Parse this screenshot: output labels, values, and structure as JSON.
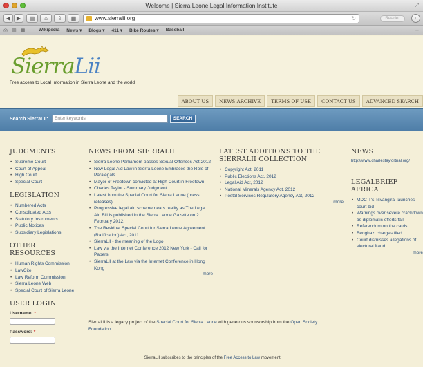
{
  "browser": {
    "window_title": "Welcome | Sierra Leone Legal Information Institute",
    "url": "www.sierralii.org",
    "reader_label": "Reader",
    "bookmarks": [
      "Wikipedia",
      "News ▾",
      "Blogs ▾",
      "411 ▾",
      "Bike Routes ▾",
      "Baseball"
    ]
  },
  "site": {
    "logo_part1": "Sierra",
    "logo_part2": "Lii",
    "tagline": "Free access to Local Information in Sierra Leone and the world",
    "nav": [
      "ABOUT US",
      "NEWS ARCHIVE",
      "TERMS OF USE",
      "CONTACT US",
      "ADVANCED SEARCH"
    ],
    "search": {
      "label": "Search SierraLII:",
      "placeholder": "Enter keywords",
      "button": "SEARCH"
    }
  },
  "judgments": {
    "heading": "JUDGMENTS",
    "items": [
      "Supreme Court",
      "Court of Appeal",
      "High Court",
      "Special Court"
    ]
  },
  "legislation": {
    "heading": "LEGISLATION",
    "items": [
      "Numbered Acts",
      "Consolidated Acts",
      "Statutory Instruments",
      "Public Notices",
      "Subsidiary Legislations"
    ]
  },
  "other_resources": {
    "heading": "OTHER RESOURCES",
    "items": [
      "Human Rights Commission",
      "LawCite",
      "Law Reform Commission",
      "Sierra Leone Web",
      "Special Court of Sierra Leone"
    ]
  },
  "login": {
    "heading": "USER LOGIN",
    "username_label": "Username:",
    "password_label": "Password:",
    "required_mark": "*"
  },
  "news": {
    "heading": "NEWS FROM SIERRALII",
    "items": [
      "Sierra Leone Parliament passes Sexual Offences Act 2012",
      "New Legal Aid Law in Sierra Leone Embraces the Role of Paralegals",
      "Mayor of Freetown convicted at High Court in Freetown",
      "Charles Taylor - Summary Judgment",
      "Latest from the Special Court for Sierra Leone (press releases)",
      "Progressive legal aid scheme nears reality as The Legal Aid Bill is published in the Sierra Leone Gazette on 2 February 2012.",
      "The Residual Special Court for Sierra Leone Agreement (Ratification) Act, 2011",
      "SierraLII - the meaning of the Logo",
      "Law via the Internet Conference 2012 New York - Call for Papers",
      "SierraLII at the Law via the Internet Conference in Hong Kong"
    ],
    "more": "more"
  },
  "latest": {
    "heading": "LATEST ADDITIONS TO THE SIERRALII COLLECTION",
    "items": [
      "Copyright Act, 2011",
      "Public Elections Act, 2012",
      "Legal Aid Act, 2012",
      "National Minerals Agency Act, 2012",
      "Postal Services Regulatory Agency Act, 2012"
    ],
    "more": "more"
  },
  "right_news": {
    "heading": "NEWS",
    "link": "http://www.charlestaylortrial.org/"
  },
  "legalbrief": {
    "heading": "LEGALBRIEF AFRICA",
    "items": [
      "MDC-T's Tsvangirai launches court bid",
      "Warnings over severe crackdown as diplomatic efforts fail",
      "Referendum on the cards",
      "Benghazi charges filed",
      "Court dismisses allegations of electoral fraud"
    ],
    "more": "more"
  },
  "footer": {
    "legacy_pre": "SierraLII is a legacy project of the ",
    "legacy_link": "Special Court for Sierra Leone",
    "legacy_mid": " with generous sponsorship from the ",
    "legacy_link2": "Open Society Foundation",
    "legacy_end": ".",
    "principles_pre": "SierraLII subscribes to the principles of the ",
    "principles_link": "Free Access to Law",
    "principles_end": " movement."
  }
}
